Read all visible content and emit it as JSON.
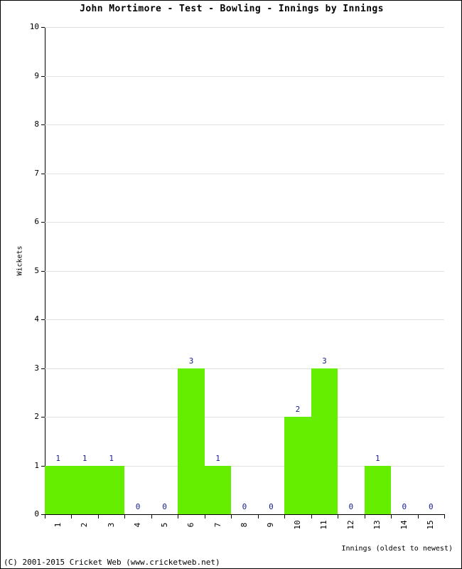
{
  "chart_data": {
    "type": "bar",
    "title": "John Mortimore - Test - Bowling - Innings by Innings",
    "xlabel": "Innings (oldest to newest)",
    "ylabel": "Wickets",
    "categories": [
      "1",
      "2",
      "3",
      "4",
      "5",
      "6",
      "7",
      "8",
      "9",
      "10",
      "11",
      "12",
      "13",
      "14",
      "15"
    ],
    "values": [
      1,
      1,
      1,
      0,
      0,
      3,
      1,
      0,
      0,
      2,
      3,
      0,
      1,
      0,
      0
    ],
    "data_labels": [
      "1",
      "1",
      "1",
      "0",
      "0",
      "3",
      "1",
      "0",
      "0",
      "2",
      "3",
      "0",
      "1",
      "0",
      "0"
    ],
    "ylim": [
      0,
      10
    ],
    "yticks": [
      0,
      1,
      2,
      3,
      4,
      5,
      6,
      7,
      8,
      9,
      10
    ],
    "ytick_labels": [
      "0",
      "1",
      "2",
      "3",
      "4",
      "5",
      "6",
      "7",
      "8",
      "9",
      "10"
    ],
    "grid": true,
    "grid_color": "#e2e2e2",
    "bar_color": "#66ee00",
    "data_label_color": "#1b1b8f",
    "legend": null,
    "legend_position": "none"
  },
  "footer": {
    "copyright": "(C) 2001-2015 Cricket Web (www.cricketweb.net)"
  }
}
